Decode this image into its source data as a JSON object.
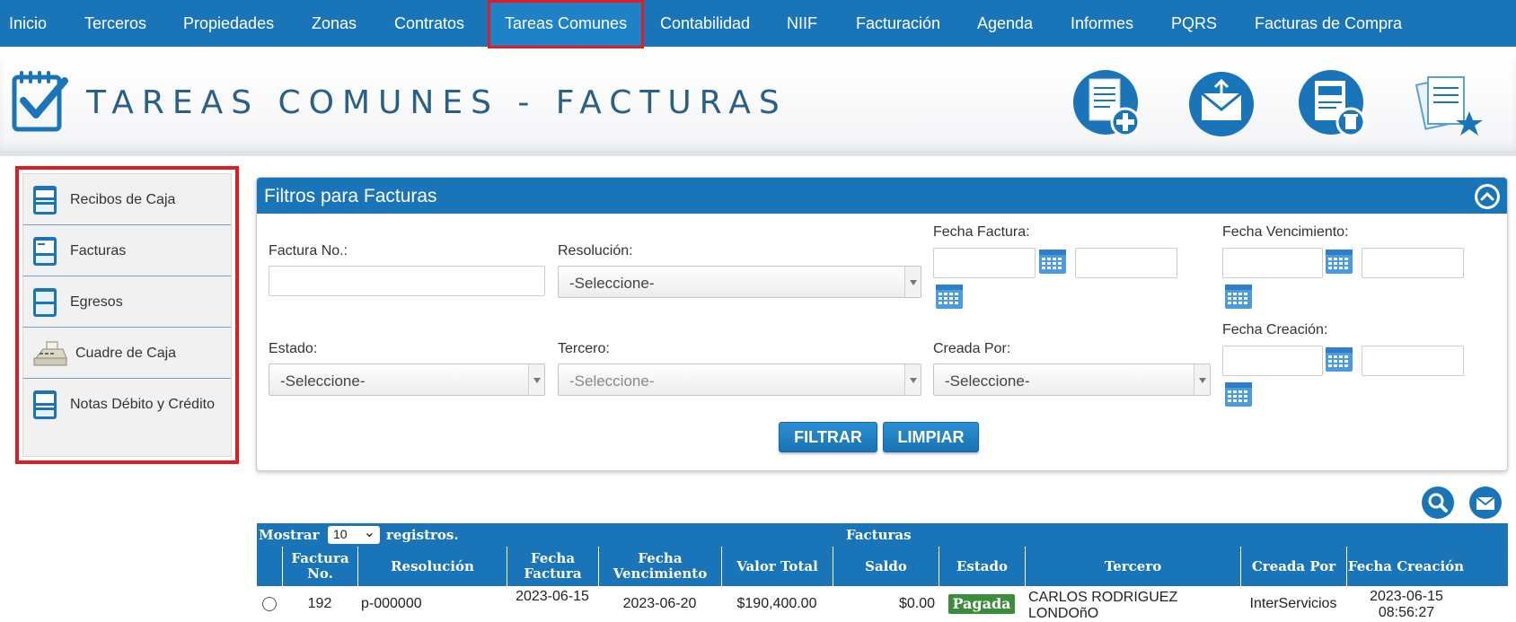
{
  "nav": {
    "items": [
      "Inicio",
      "Terceros",
      "Propiedades",
      "Zonas",
      "Contratos",
      "Tareas Comunes",
      "Contabilidad",
      "NIIF",
      "Facturación",
      "Agenda",
      "Informes",
      "PQRS",
      "Facturas de Compra"
    ],
    "active": "Tareas Comunes"
  },
  "header": {
    "title": "TAREAS COMUNES - FACTURAS",
    "actions": [
      "new-invoice-icon",
      "send-mail-icon",
      "delete-invoice-icon",
      "favorite-documents-icon"
    ]
  },
  "sidebar": {
    "items": [
      {
        "label": "Recibos de Caja",
        "icon": "receipt-icon"
      },
      {
        "label": "Facturas",
        "icon": "invoice-icon"
      },
      {
        "label": "Egresos",
        "icon": "expense-icon"
      },
      {
        "label": "Cuadre de Caja",
        "icon": "cash-register-icon"
      },
      {
        "label": "Notas Débito y Crédito",
        "icon": "notes-icon"
      }
    ]
  },
  "filters": {
    "title": "Filtros para Facturas",
    "factura_no_label": "Factura No.:",
    "resolucion_label": "Resolución:",
    "resolucion_value": "-Seleccione-",
    "fecha_factura_label": "Fecha Factura:",
    "fecha_vencimiento_label": "Fecha Vencimiento:",
    "estado_label": "Estado:",
    "estado_value": "-Seleccione-",
    "tercero_label": "Tercero:",
    "tercero_value": "-Seleccione-",
    "creada_por_label": "Creada Por:",
    "creada_por_value": "-Seleccione-",
    "fecha_creacion_label": "Fecha Creación:",
    "filtrar_label": "FILTRAR",
    "limpiar_label": "LIMPIAR"
  },
  "table": {
    "mostrar_label": "Mostrar",
    "page_size": "10",
    "registros_label": "registros.",
    "title": "Facturas",
    "columns": [
      "Factura No.",
      "Resolución",
      "Fecha Factura",
      "Fecha Vencimiento",
      "Valor Total",
      "Saldo",
      "Estado",
      "Tercero",
      "Creada Por",
      "Fecha Creación"
    ],
    "rows": [
      {
        "factura_no": "192",
        "resolucion": "p-000000",
        "fecha_factura": "2023-06-15",
        "fecha_vencimiento": "2023-06-20",
        "valor_total": "$190,400.00",
        "saldo": "$0.00",
        "estado": "Pagada",
        "tercero": "CARLOS RODRIGUEZ LONDOñO",
        "creada_por": "InterServicios",
        "fecha_creacion": "2023-06-15 08:56:27"
      }
    ]
  },
  "colors": {
    "primary": "#1a75b8",
    "highlight": "#e21b22",
    "paid": "#3d8b3d"
  }
}
